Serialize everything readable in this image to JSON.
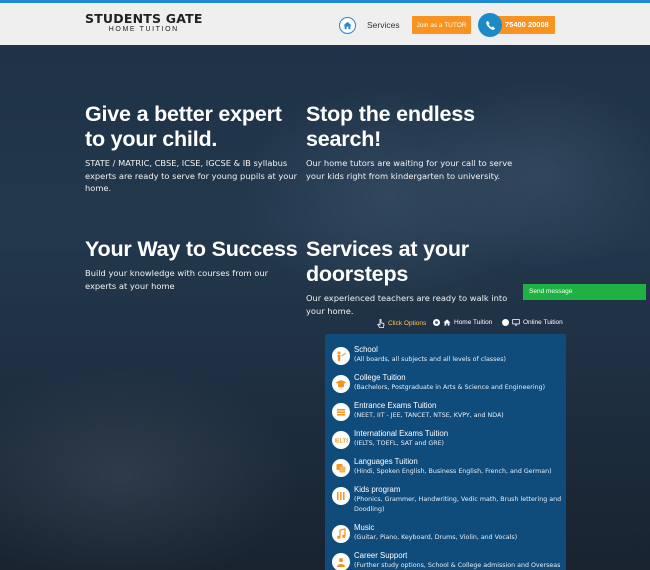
{
  "header": {
    "logo_line1": "STUDENTS GATE",
    "logo_line2": "HOME TUITION",
    "nav_services": "Services",
    "join_tutor": "Join as a TUTOR",
    "phone": "75400 20008"
  },
  "hero": {
    "block1": {
      "title": "Give a better expert to your child.",
      "text": "STATE / MATRIC, CBSE, ICSE, IGCSE & IB syllabus experts are ready to serve for young pupils at your home."
    },
    "block2": {
      "title": "Stop the endless search!",
      "text": "Our home tutors are waiting for your call to serve your kids right from kindergarten to university."
    },
    "block3": {
      "title": "Your Way to Success",
      "text": "Build your knowledge with courses from our experts at your home"
    },
    "block4": {
      "title": "Services at your doorsteps",
      "text": "Our experienced teachers are ready to walk into your home."
    }
  },
  "send_message": "Send message",
  "options": {
    "click_label": "Click Options",
    "home_tuition": "Home Tuition",
    "online_tuition": "Online Tuition",
    "selected": "Home Tuition"
  },
  "services": [
    {
      "icon": "school-icon",
      "title": "School",
      "desc": "(All boards, all subjects and all levels of classes)"
    },
    {
      "icon": "college-icon",
      "title": "College Tuition",
      "desc": "(Bachelors, Postgraduate in Arts & Science and Engineering)"
    },
    {
      "icon": "exam-icon",
      "title": "Entrance Exams Tuition",
      "desc": "(NEET, IIT - JEE, TANCET, NTSE, KVPY, and NDA)"
    },
    {
      "icon": "ielts-icon",
      "title": "International Exams Tuition",
      "desc": "(IELTS, TOEFL, SAT and GRE)"
    },
    {
      "icon": "languages-icon",
      "title": "Languages Tuition",
      "desc": "(Hindi, Spoken English, Business English, French, and German)"
    },
    {
      "icon": "kids-icon",
      "title": "Kids program",
      "desc": "(Phonics, Grammer, Handwriting, Vedic math, Brush lettering and Doodling)"
    },
    {
      "icon": "music-icon",
      "title": "Music",
      "desc": "(Guitar, Piano, Keyboard, Drums, Violin, and Vocals)"
    },
    {
      "icon": "career-icon",
      "title": "Career Support",
      "desc": "(Further study options, School & College admission and Overseas"
    }
  ],
  "colors": {
    "accent_blue": "#1e88d6",
    "orange": "#f7931e",
    "green": "#1fb141",
    "panel": "#0f4c7c"
  }
}
